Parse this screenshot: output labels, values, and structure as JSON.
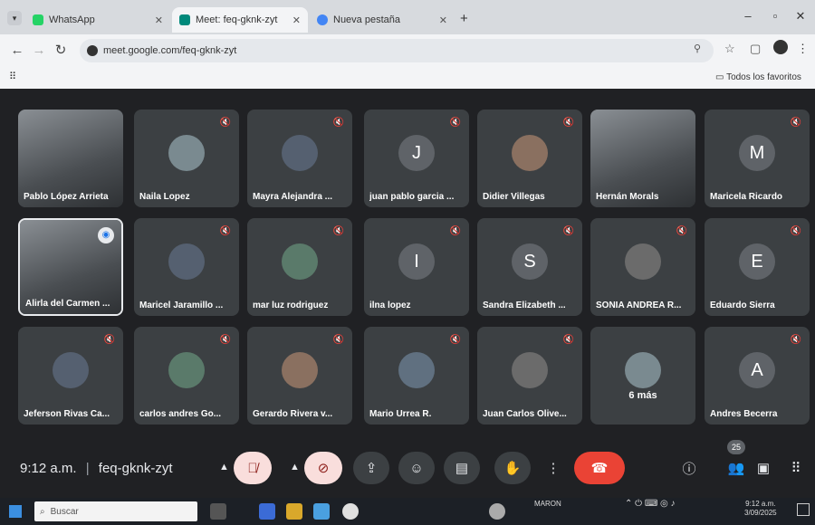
{
  "browser": {
    "tabs": [
      {
        "label": "WhatsApp",
        "active": false
      },
      {
        "label": "Meet: feq-gknk-zyt",
        "active": true
      },
      {
        "label": "Nueva pestaña",
        "active": false
      }
    ],
    "new_tab": "+",
    "address": "meet.google.com/feq-gknk-zyt",
    "bookmarks_right": "Todos los favoritos"
  },
  "meet": {
    "participants": [
      {
        "name": "Pablo López Arrieta",
        "type": "video",
        "muted": false
      },
      {
        "name": "Naila Lopez",
        "type": "avatar",
        "muted": true
      },
      {
        "name": "Mayra Alejandra ...",
        "type": "avatar",
        "muted": true
      },
      {
        "name": "juan pablo garcia ...",
        "type": "letter",
        "letter": "J",
        "muted": true
      },
      {
        "name": "Didier Villegas",
        "type": "avatar",
        "muted": true
      },
      {
        "name": "Hernán Morals",
        "type": "video",
        "muted": false
      },
      {
        "name": "Maricela Ricardo",
        "type": "letter",
        "letter": "M",
        "muted": true
      },
      {
        "name": "Alirla del Carmen ...",
        "type": "video",
        "muted": false,
        "speaking": true
      },
      {
        "name": "Maricel Jaramillo ...",
        "type": "avatar",
        "muted": true
      },
      {
        "name": "mar luz rodriguez",
        "type": "avatar",
        "muted": true
      },
      {
        "name": "ilna lopez",
        "type": "letter",
        "letter": "I",
        "muted": true
      },
      {
        "name": "Sandra Elizabeth ...",
        "type": "letter",
        "letter": "S",
        "muted": true
      },
      {
        "name": "SONIA ANDREA R...",
        "type": "avatar",
        "muted": true
      },
      {
        "name": "Eduardo Sierra",
        "type": "letter",
        "letter": "E",
        "muted": true
      },
      {
        "name": "Jeferson Rivas Ca...",
        "type": "avatar",
        "muted": true
      },
      {
        "name": "carlos andres Go...",
        "type": "avatar",
        "muted": true
      },
      {
        "name": "Gerardo Rivera v...",
        "type": "avatar",
        "muted": true
      },
      {
        "name": "Mario Urrea R.",
        "type": "avatar",
        "muted": true
      },
      {
        "name": "Juan Carlos Olive...",
        "type": "avatar",
        "muted": true
      },
      {
        "name": "",
        "type": "more",
        "more_label": "6 más",
        "muted": false
      },
      {
        "name": "Andres Becerra",
        "type": "letter",
        "letter": "A",
        "muted": true
      }
    ],
    "time": "9:12 a.m.",
    "meeting_code": "feq-gknk-zyt",
    "separator": "|",
    "participant_count": "25"
  },
  "taskbar": {
    "search_placeholder": "Buscar",
    "weather": "MARON",
    "clock_time": "9:12 a.m.",
    "clock_date": "3/09/2025"
  },
  "colors": {
    "meet_bg": "#202124",
    "tile_bg": "#3c4043",
    "end_call": "#ea4335",
    "muted_button": "#f9dedc"
  }
}
